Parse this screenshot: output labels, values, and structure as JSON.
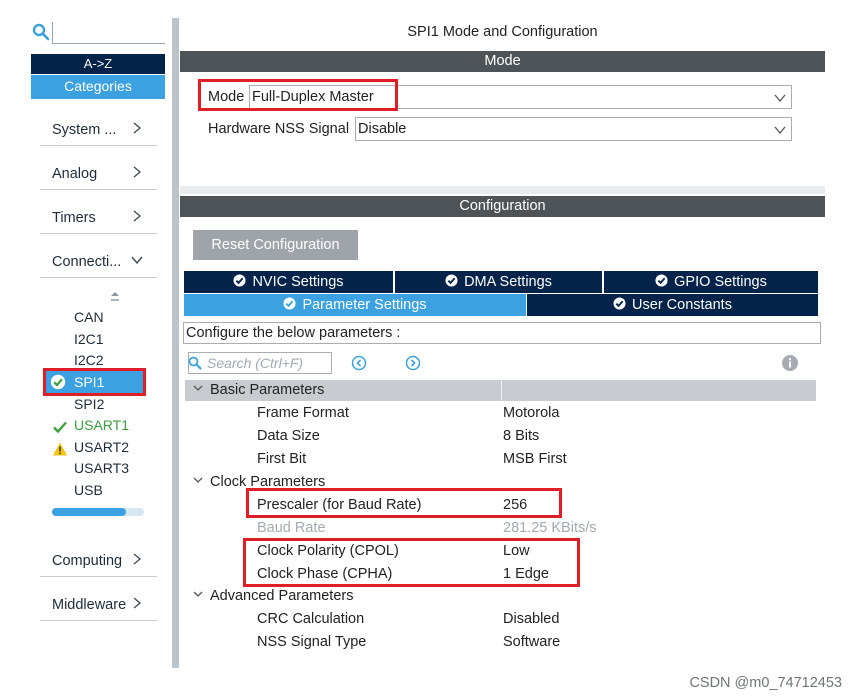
{
  "sidebar": {
    "sort_label": "A->Z",
    "categories_label": "Categories",
    "items": [
      {
        "label": "System ..."
      },
      {
        "label": "Analog"
      },
      {
        "label": "Timers"
      },
      {
        "label": "Connecti..."
      },
      {
        "label": "Computing"
      },
      {
        "label": "Middleware"
      }
    ],
    "connectivity": [
      "CAN",
      "I2C1",
      "I2C2",
      "SPI1",
      "SPI2",
      "USART1",
      "USART2",
      "USART3",
      "USB"
    ],
    "scroll_progress": 0.8
  },
  "panel": {
    "title": "SPI1 Mode and Configuration",
    "mode_header": "Mode",
    "mode_label": "Mode",
    "mode_value": "Full-Duplex Master",
    "nss_label": "Hardware NSS Signal",
    "nss_value": "Disable",
    "config_header": "Configuration",
    "reset_label": "Reset Configuration"
  },
  "tabs": {
    "nvic": "NVIC Settings",
    "dma": "DMA Settings",
    "gpio": "GPIO Settings",
    "parameter": "Parameter Settings",
    "user_constants": "User Constants"
  },
  "params": {
    "configure_text": "Configure the below parameters :",
    "search_placeholder": "Search (Ctrl+F)",
    "basic_header": "Basic Parameters",
    "frame_format_label": "Frame Format",
    "frame_format_value": "Motorola",
    "data_size_label": "Data Size",
    "data_size_value": "8 Bits",
    "first_bit_label": "First Bit",
    "first_bit_value": "MSB First",
    "clock_header": "Clock Parameters",
    "prescaler_label": "Prescaler (for Baud Rate)",
    "prescaler_value": "256",
    "baud_label": "Baud Rate",
    "baud_value": "281.25 KBits/s",
    "cpol_label": "Clock Polarity (CPOL)",
    "cpol_value": "Low",
    "cpha_label": "Clock Phase (CPHA)",
    "cpha_value": "1 Edge",
    "advanced_header": "Advanced Parameters",
    "crc_label": "CRC Calculation",
    "crc_value": "Disabled",
    "nss_type_label": "NSS Signal Type",
    "nss_type_value": "Software"
  },
  "watermark": "CSDN @m0_74712453"
}
